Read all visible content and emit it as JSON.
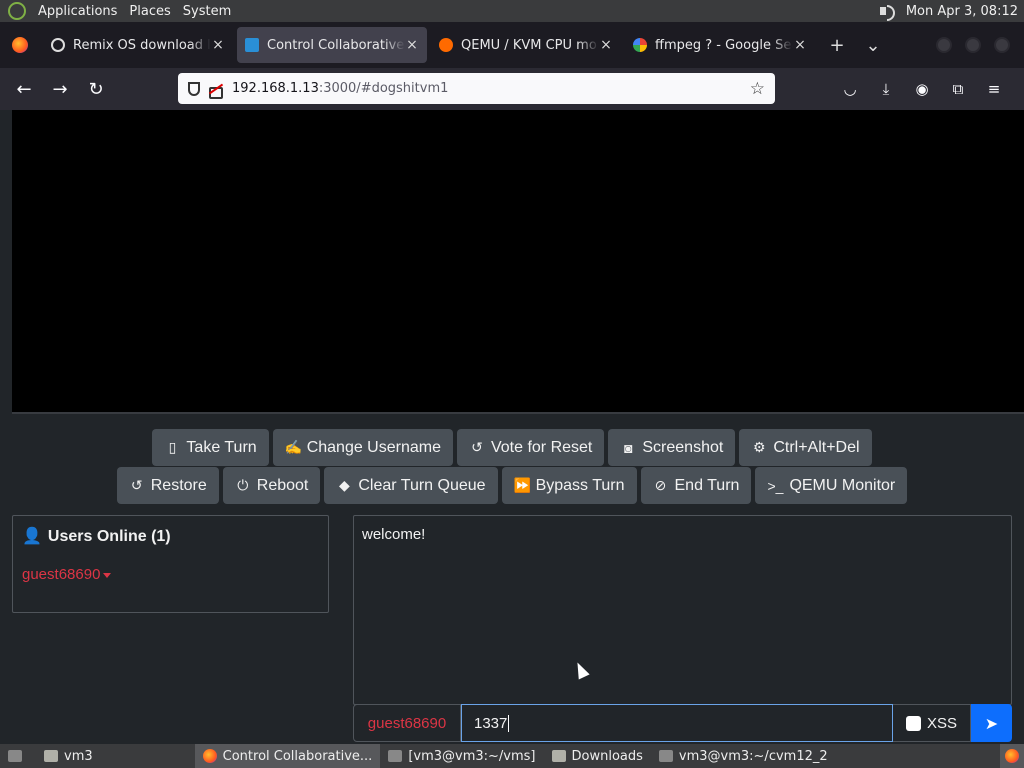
{
  "top_panel": {
    "menus": [
      "Applications",
      "Places",
      "System"
    ],
    "clock": "Mon Apr  3, 08:12"
  },
  "browser": {
    "tabs": [
      {
        "title": "Remix OS download la",
        "icon": "remix-icon"
      },
      {
        "title": "Control Collaborative V",
        "icon": "computer-icon",
        "active": true
      },
      {
        "title": "QEMU / KVM CPU mo",
        "icon": "qemu-icon"
      },
      {
        "title": "ffmpeg ? - Google Sea",
        "icon": "google-icon"
      }
    ],
    "url_host": "192.168.1.13",
    "url_rest": ":3000/#dogshitvm1"
  },
  "controls": {
    "row1": [
      {
        "label": "Take Turn",
        "icon": "mouse-icon"
      },
      {
        "label": "Change Username",
        "icon": "signature-icon"
      },
      {
        "label": "Vote for Reset",
        "icon": "undo-icon"
      },
      {
        "label": "Screenshot",
        "icon": "camera-icon"
      },
      {
        "label": "Ctrl+Alt+Del",
        "icon": "gear-icon"
      }
    ],
    "row2": [
      {
        "label": "Restore",
        "icon": "restore-icon"
      },
      {
        "label": "Reboot",
        "icon": "power-icon"
      },
      {
        "label": "Clear Turn Queue",
        "icon": "eraser-icon"
      },
      {
        "label": "Bypass Turn",
        "icon": "fast-forward-icon"
      },
      {
        "label": "End Turn",
        "icon": "ban-icon"
      },
      {
        "label": "QEMU Monitor",
        "icon": "terminal-icon"
      }
    ]
  },
  "users": {
    "title": "Users Online (1)",
    "list": [
      "guest68690"
    ]
  },
  "chat": {
    "messages": [
      "welcome!"
    ],
    "username": "guest68690",
    "input_value": "1337",
    "xss_label": "XSS"
  },
  "taskbar": {
    "items": [
      "vm3",
      "Control Collaborative...",
      "[vm3@vm3:~/vms]",
      "Downloads",
      "vm3@vm3:~/cvm12_2"
    ]
  },
  "colors": {
    "accent": "#0d6efd",
    "username": "#dc3545",
    "button_bg": "#495057",
    "page_bg": "#212529"
  }
}
